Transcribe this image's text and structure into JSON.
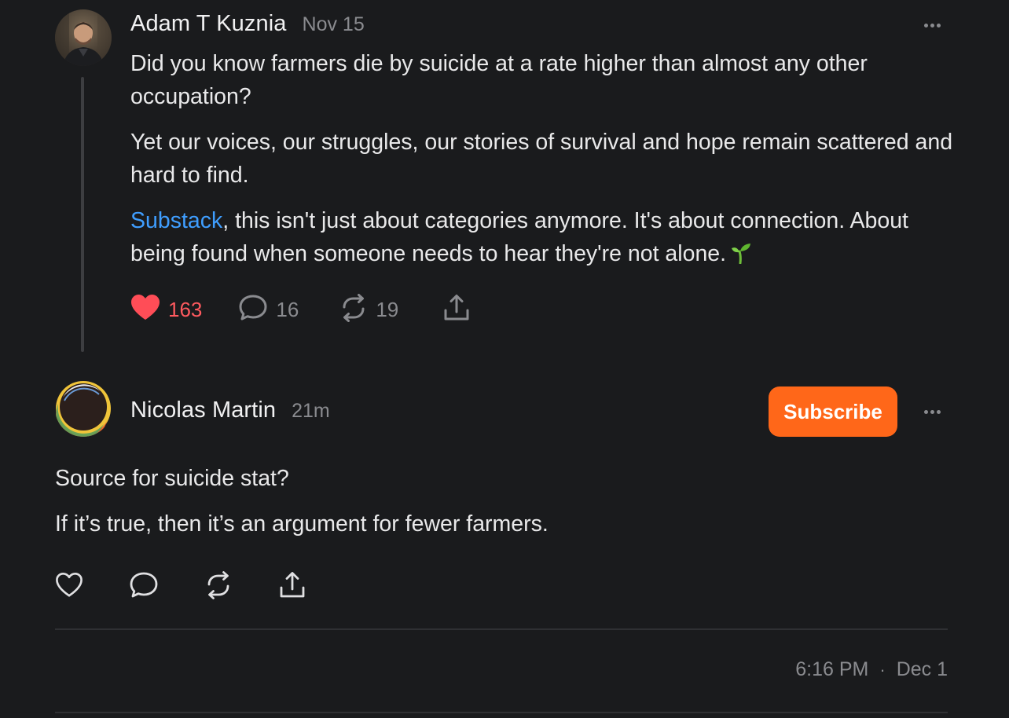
{
  "parent_post": {
    "author": "Adam T Kuznia",
    "time": "Nov 15",
    "paragraphs": [
      "Did you know farmers die by suicide at a rate higher than almost any other occupation?",
      "Yet our voices, our struggles, our stories of survival and hope remain scattered and hard to find."
    ],
    "mention": "Substack",
    "mention_tail": ", this isn't just about categories anymore. It's about connection. About being found when someone needs to hear they're not alone.",
    "likes": "163",
    "comments": "16",
    "restacks": "19",
    "icons": [
      "heart-filled-icon",
      "comment-icon",
      "restack-icon",
      "share-icon",
      "sprout-emoji-icon",
      "more-icon"
    ]
  },
  "reply": {
    "author": "Nicolas Martin",
    "time": "21m",
    "subscribe_label": "Subscribe",
    "paragraphs": [
      "Source for suicide stat?",
      "If it’s true, then it’s an argument for fewer farmers."
    ],
    "timestamp_time": "6:16 PM",
    "timestamp_separator": "·",
    "timestamp_date": "Dec 1",
    "icons": [
      "heart-outline-icon",
      "comment-icon",
      "restack-icon",
      "share-icon",
      "more-icon"
    ]
  },
  "colors": {
    "background": "#1a1b1d",
    "text": "#e9e9ea",
    "muted": "#8a8b8f",
    "link": "#3f9eff",
    "like": "#ff5a5f",
    "subscribe": "#ff6719"
  }
}
